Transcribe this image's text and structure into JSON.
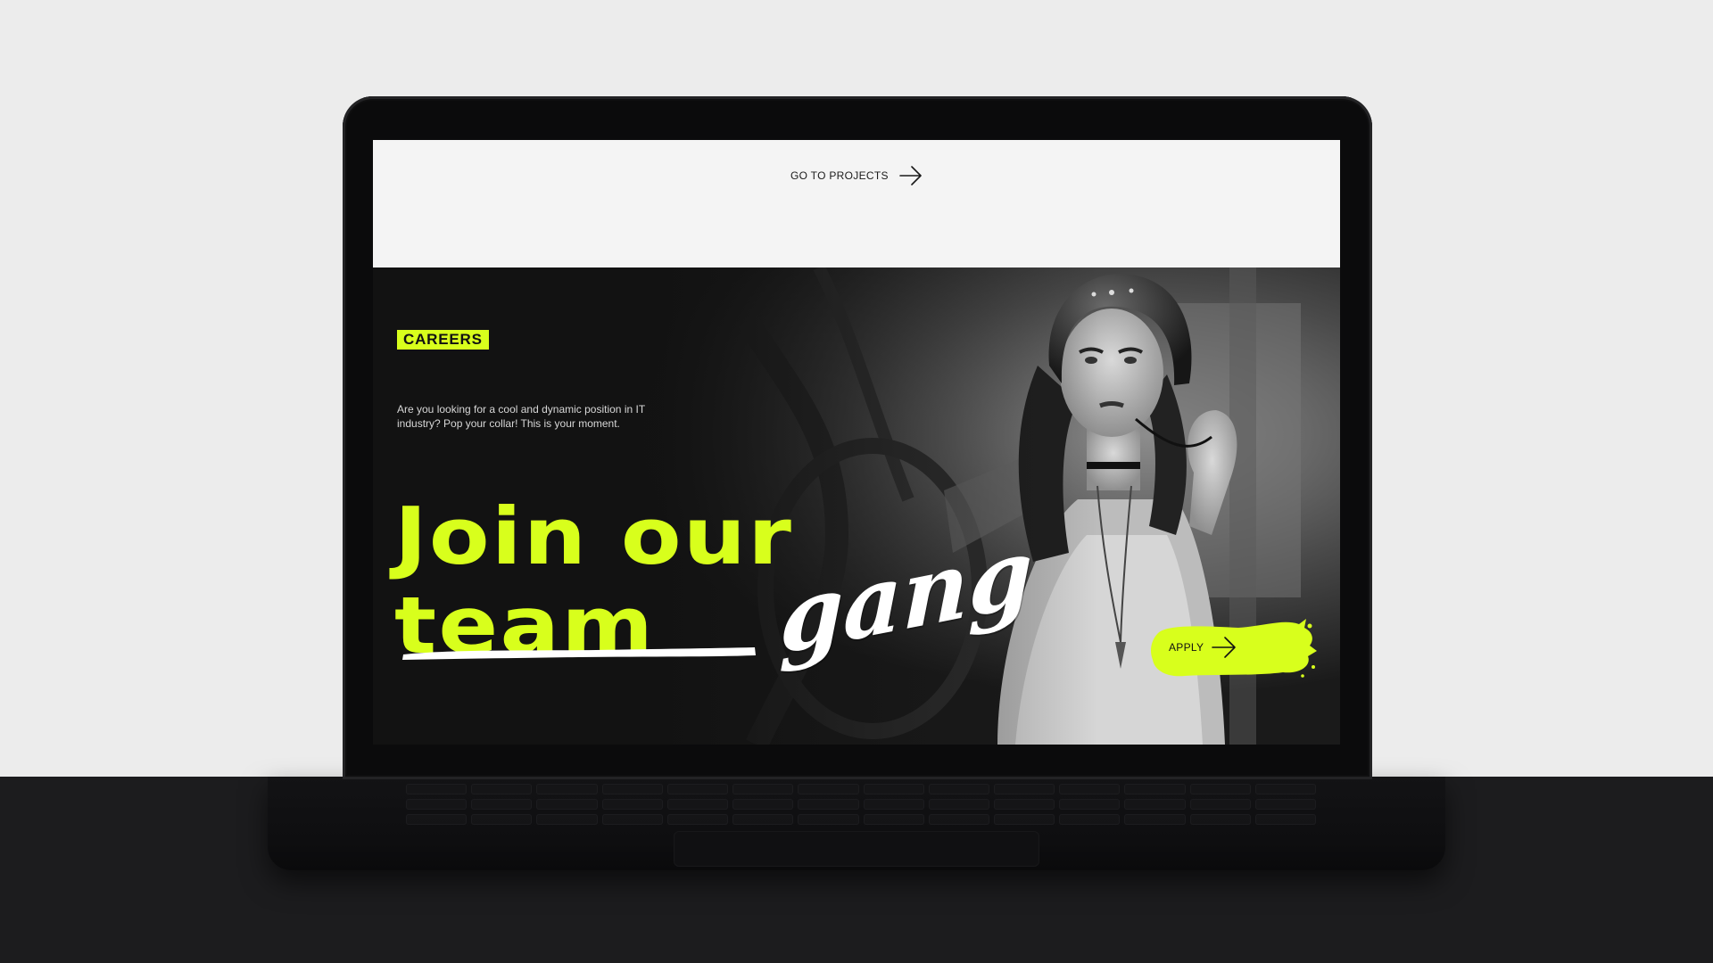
{
  "nav": {
    "go_to_projects": "GO TO PROJECTS",
    "arrow_icon": "arrow-right-icon"
  },
  "hero": {
    "badge": "CAREERS",
    "intro": "Are you looking for a cool and dynamic position in IT industry? Pop your collar! This is your moment.",
    "headline_line1": "Join our",
    "headline_struck": "team",
    "headline_script": "gang",
    "apply_label": "APPLY",
    "apply_icon": "arrow-right-icon"
  },
  "colors": {
    "accent": "#d8ff1c",
    "hero_bg": "#121212",
    "top_bg": "#f4f4f4",
    "page_bg": "#ececec"
  }
}
